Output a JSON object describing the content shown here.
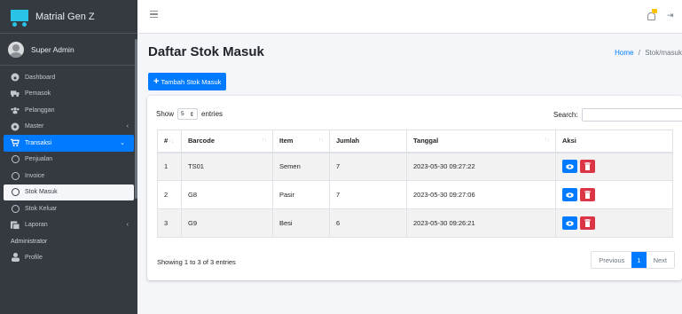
{
  "brand": {
    "name": "Matrial Gen Z"
  },
  "user": {
    "name": "Super Admin"
  },
  "sidebar": {
    "items": [
      {
        "label": "Dashboard"
      },
      {
        "label": "Pemasok"
      },
      {
        "label": "Pelanggan"
      },
      {
        "label": "Master"
      },
      {
        "label": "Transaksi"
      },
      {
        "label": "Penjualan"
      },
      {
        "label": "Invoice"
      },
      {
        "label": "Stok Masuk"
      },
      {
        "label": "Stok Keluar"
      },
      {
        "label": "Laporan"
      }
    ],
    "header": "Administrator",
    "profile": "Profile"
  },
  "page": {
    "title": "Daftar Stok Masuk",
    "breadcrumb_home": "Home",
    "breadcrumb_sep": "/",
    "breadcrumb_current": "Stok/masuk",
    "add_button": "Tambah Stok Masuk"
  },
  "table_controls": {
    "show": "Show",
    "entries": "entries",
    "page_size": "5",
    "search_label": "Search:"
  },
  "table": {
    "headers": [
      "#",
      "Barcode",
      "Item",
      "Jumlah",
      "Tanggal",
      "Aksi"
    ],
    "rows": [
      {
        "no": "1",
        "barcode": "TS01",
        "item": "Semen",
        "jumlah": "7",
        "tanggal": "2023-05-30 09:27:22"
      },
      {
        "no": "2",
        "barcode": "G8",
        "item": "Pasir",
        "jumlah": "7",
        "tanggal": "2023-05-30 09:27:06"
      },
      {
        "no": "3",
        "barcode": "G9",
        "item": "Besi",
        "jumlah": "6",
        "tanggal": "2023-05-30 09:26:21"
      }
    ]
  },
  "footer": {
    "info": "Showing 1 to 3 of 3 entries",
    "previous": "Previous",
    "page": "1",
    "next": "Next"
  },
  "colors": {
    "primary": "#007bff",
    "danger": "#dc3545",
    "sidebar": "#343a40",
    "accent": "#28c3e6",
    "warning": "#ffc107"
  }
}
